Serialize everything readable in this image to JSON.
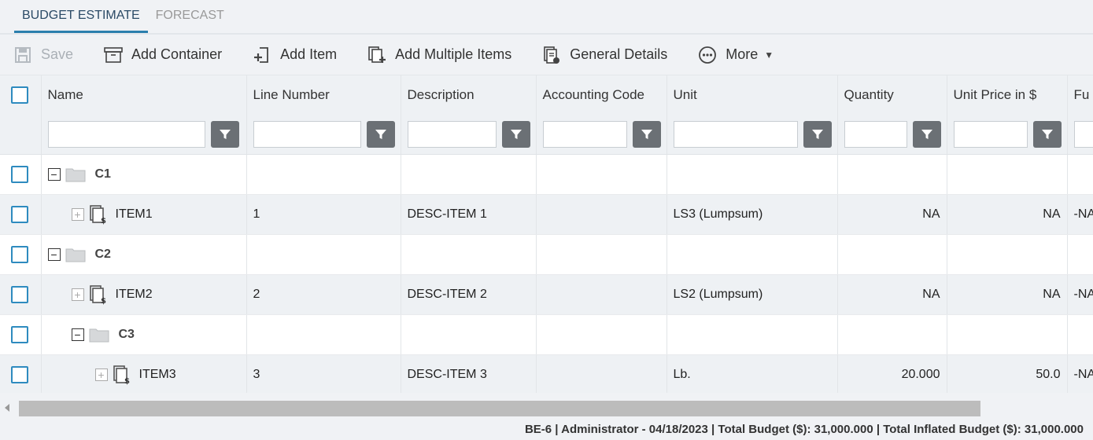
{
  "tabs": [
    {
      "label": "BUDGET ESTIMATE",
      "active": true
    },
    {
      "label": "FORECAST",
      "active": false
    }
  ],
  "toolbar": {
    "save": "Save",
    "add_container": "Add Container",
    "add_item": "Add Item",
    "add_multiple": "Add Multiple Items",
    "general_details": "General Details",
    "more": "More"
  },
  "columns": {
    "name": "Name",
    "line_number": "Line Number",
    "description": "Description",
    "accounting_code": "Accounting Code",
    "unit": "Unit",
    "quantity": "Quantity",
    "unit_price": "Unit Price in $",
    "next": "Fu"
  },
  "rows": [
    {
      "name": "C1",
      "type": "container",
      "level": 0,
      "line": "",
      "desc": "",
      "code": "",
      "unit": "",
      "qty": "",
      "price": "",
      "next": ""
    },
    {
      "name": "ITEM1",
      "type": "item",
      "level": 1,
      "line": "1",
      "desc": "DESC-ITEM 1",
      "code": "",
      "unit": "LS3 (Lumpsum)",
      "qty": "NA",
      "price": "NA",
      "next": "-NA"
    },
    {
      "name": "C2",
      "type": "container",
      "level": 0,
      "line": "",
      "desc": "",
      "code": "",
      "unit": "",
      "qty": "",
      "price": "",
      "next": ""
    },
    {
      "name": "ITEM2",
      "type": "item",
      "level": 1,
      "line": "2",
      "desc": "DESC-ITEM 2",
      "code": "",
      "unit": "LS2 (Lumpsum)",
      "qty": "NA",
      "price": "NA",
      "next": "-NA"
    },
    {
      "name": "C3",
      "type": "container",
      "level": 1,
      "line": "",
      "desc": "",
      "code": "",
      "unit": "",
      "qty": "",
      "price": "",
      "next": ""
    },
    {
      "name": "ITEM3",
      "type": "item",
      "level": 2,
      "line": "3",
      "desc": "DESC-ITEM 3",
      "code": "",
      "unit": "Lb.",
      "qty": "20.000",
      "price": "50.0",
      "next": "-NA"
    }
  ],
  "status": "BE-6 | Administrator - 04/18/2023 | Total Budget ($): 31,000.000 | Total Inflated Budget ($): 31,000.000",
  "colors": {
    "accent": "#2e8bbf",
    "filter_button": "#6b7075",
    "alt_row": "#eef1f4"
  }
}
